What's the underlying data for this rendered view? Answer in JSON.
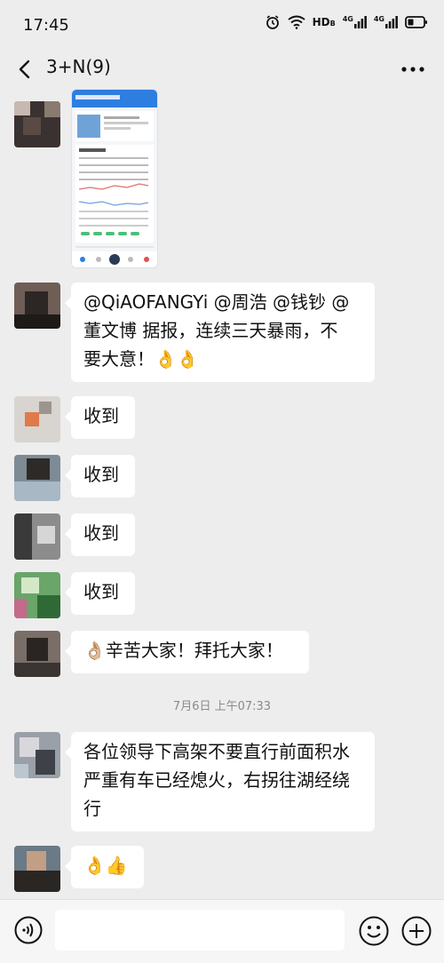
{
  "status_bar": {
    "time": "17:45",
    "network_label": "HD",
    "network_sub": "B",
    "signal1": "4G",
    "signal2": "4G"
  },
  "header": {
    "title": "3+N(9)"
  },
  "messages": [
    {
      "type": "image",
      "sender_avatar": "avatar-1",
      "content": "screenshot of weather app forecast"
    },
    {
      "type": "text",
      "text_line1": "@QiAOFANGYi @周浩  @钱钞  @",
      "text_line2": "董文博  据报，连续三天暴雨，不",
      "text_line3": "要大意！",
      "emoji": "👌👌"
    },
    {
      "type": "text",
      "text": "收到"
    },
    {
      "type": "text",
      "text": "收到"
    },
    {
      "type": "text",
      "text": "收到"
    },
    {
      "type": "text",
      "text": "收到"
    },
    {
      "type": "text",
      "text": "辛苦大家！拜托大家！",
      "emoji": "👌🏼"
    },
    {
      "type": "timestamp",
      "text": "7月6日 上午07:33"
    },
    {
      "type": "text",
      "text_line1": "各位领导下高架不要直行前面积水",
      "text_line2": "严重有车已经熄火，右拐往湖经绕",
      "text_line3": "行"
    },
    {
      "type": "text",
      "emoji": "👌👍"
    }
  ],
  "colors": {
    "background": "#ededed",
    "bubble": "#ffffff",
    "timestamp": "#8a8a8a"
  }
}
